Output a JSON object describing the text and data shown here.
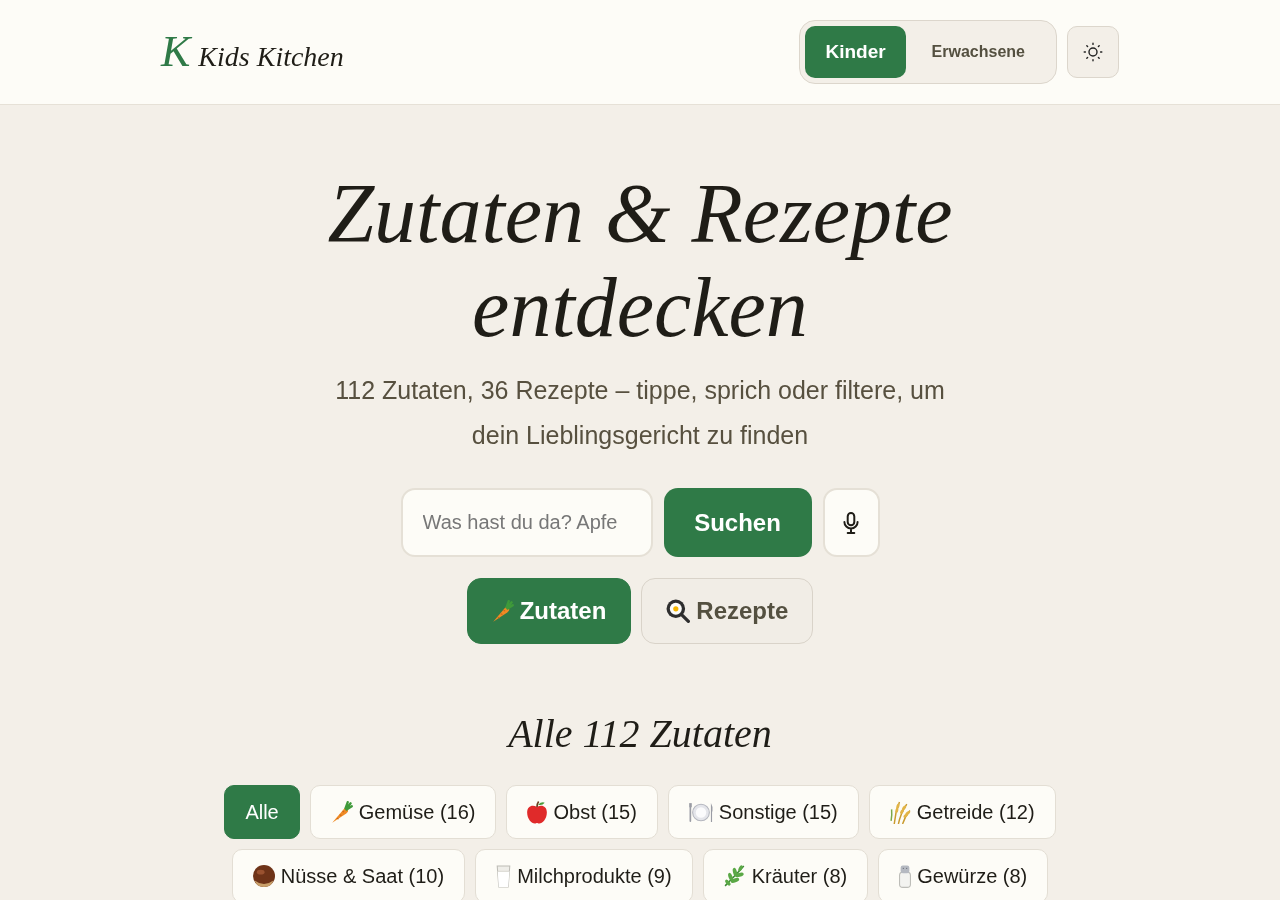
{
  "header": {
    "logo": {
      "mark": "K",
      "name": "Kids Kitchen"
    },
    "audience_toggle": [
      {
        "label": "Kinder",
        "selected": true
      },
      {
        "label": "Erwachsene",
        "selected": false
      }
    ]
  },
  "hero": {
    "title": "Zutaten & Rezepte entdecken",
    "subtitle": "112 Zutaten, 36 Rezepte – tippe, sprich oder filtere, um dein Lieblingsgericht zu finden",
    "search": {
      "placeholder": "Was hast du da? Apfe",
      "button": "Suchen"
    },
    "mode_tabs": [
      {
        "label": "Zutaten",
        "kind": "vegetable",
        "selected": true
      },
      {
        "label": "Rezepte",
        "kind": "cooking",
        "selected": false
      }
    ]
  },
  "ingredients": {
    "title": "Alle 112 Zutaten",
    "filters": [
      {
        "label": "Alle",
        "kind": "all",
        "selected": true
      },
      {
        "label": "Gemüse (16)",
        "kind": "vegetable",
        "selected": false
      },
      {
        "label": "Obst (15)",
        "kind": "fruit",
        "selected": false
      },
      {
        "label": "Sonstige (15)",
        "kind": "other",
        "selected": false
      },
      {
        "label": "Getreide (12)",
        "kind": "grain",
        "selected": false
      },
      {
        "label": "Nüsse & Saat (10)",
        "kind": "nuts",
        "selected": false
      },
      {
        "label": "Milchprodukte (9)",
        "kind": "dairy",
        "selected": false
      },
      {
        "label": "Kräuter (8)",
        "kind": "herbs",
        "selected": false
      },
      {
        "label": "Gewürze (8)",
        "kind": "spices",
        "selected": false
      }
    ]
  }
}
